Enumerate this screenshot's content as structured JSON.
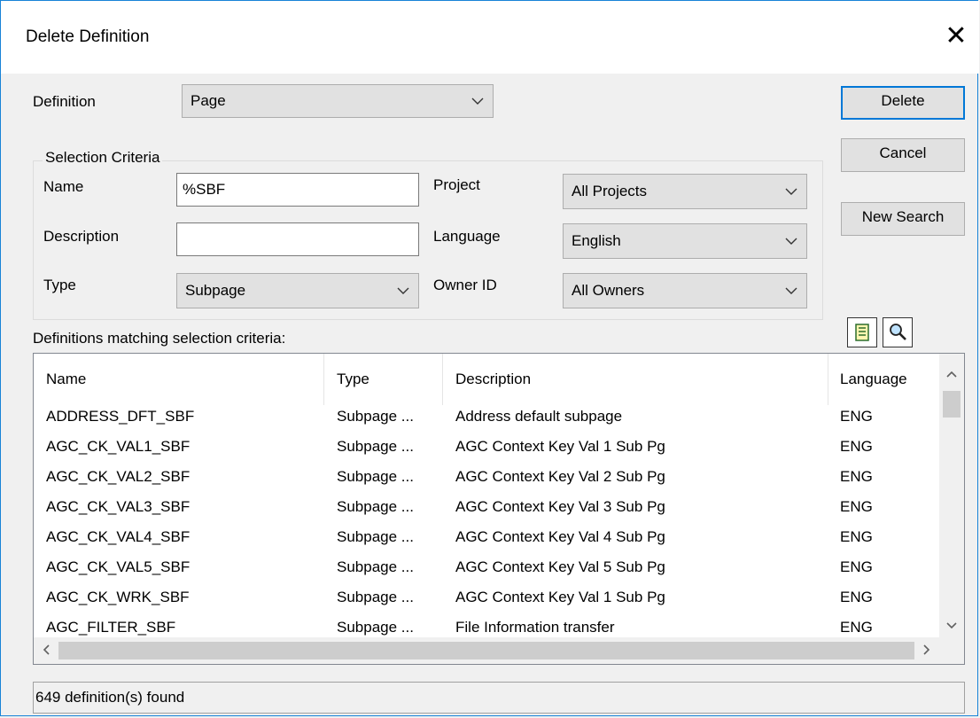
{
  "window": {
    "title": "Delete Definition"
  },
  "definition": {
    "label": "Definition",
    "value": "Page"
  },
  "buttons": {
    "delete": "Delete",
    "cancel": "Cancel",
    "new_search": "New Search"
  },
  "criteria": {
    "legend": "Selection Criteria",
    "name_label": "Name",
    "name_value": "%SBF",
    "description_label": "Description",
    "description_value": "",
    "type_label": "Type",
    "type_value": "Subpage",
    "project_label": "Project",
    "project_value": "All Projects",
    "language_label": "Language",
    "language_value": "English",
    "owner_label": "Owner ID",
    "owner_value": "All Owners"
  },
  "results": {
    "label": "Definitions matching selection criteria:",
    "columns": [
      "Name",
      "Type",
      "Description",
      "Language"
    ],
    "rows": [
      {
        "name": "ADDRESS_DFT_SBF",
        "type": "Subpage ...",
        "description": "Address default subpage",
        "language": "ENG"
      },
      {
        "name": "AGC_CK_VAL1_SBF",
        "type": "Subpage ...",
        "description": "AGC Context Key Val 1 Sub Pg",
        "language": "ENG"
      },
      {
        "name": "AGC_CK_VAL2_SBF",
        "type": "Subpage ...",
        "description": "AGC Context Key Val 2 Sub Pg",
        "language": "ENG"
      },
      {
        "name": "AGC_CK_VAL3_SBF",
        "type": "Subpage ...",
        "description": "AGC Context Key Val 3 Sub Pg",
        "language": "ENG"
      },
      {
        "name": "AGC_CK_VAL4_SBF",
        "type": "Subpage ...",
        "description": "AGC Context Key Val 4 Sub Pg",
        "language": "ENG"
      },
      {
        "name": "AGC_CK_VAL5_SBF",
        "type": "Subpage ...",
        "description": "AGC Context Key Val 5 Sub Pg",
        "language": "ENG"
      },
      {
        "name": "AGC_CK_WRK_SBF",
        "type": "Subpage ...",
        "description": "AGC Context Key Val 1 Sub Pg",
        "language": "ENG"
      },
      {
        "name": "AGC_FILTER_SBF",
        "type": "Subpage ...",
        "description": "File Information transfer",
        "language": "ENG"
      }
    ]
  },
  "status": {
    "text": "649 definition(s) found"
  },
  "icons": {
    "close": "close-icon",
    "chevron": "chevron-down-icon",
    "list": "list-icon",
    "search": "search-icon"
  }
}
